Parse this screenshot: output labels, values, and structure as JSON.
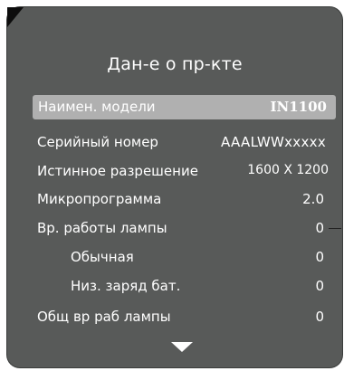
{
  "title": "Дан-е о пр-кте",
  "rows": [
    {
      "label": "Наимен. модели",
      "value": "IN1100"
    },
    {
      "label": "Серийный номер",
      "value": "AAALWWxxxxx"
    },
    {
      "label": "Истинное разрешение",
      "value": "1600 X 1200"
    },
    {
      "label": "Микропрограмма",
      "value": "2.0"
    },
    {
      "label": "Вр. работы лампы",
      "value": "0"
    },
    {
      "label": "Обычная",
      "value": "0"
    },
    {
      "label": "Низ. заряд бат.",
      "value": "0"
    },
    {
      "label": "Общ вр раб лампы",
      "value": "0"
    }
  ],
  "selected_row": "Наимен. модели",
  "scroll_indicator": "down-arrow-icon",
  "colors": {
    "panel": "#585a59",
    "highlight": "#b0b0b0",
    "text": "#ffffff"
  }
}
